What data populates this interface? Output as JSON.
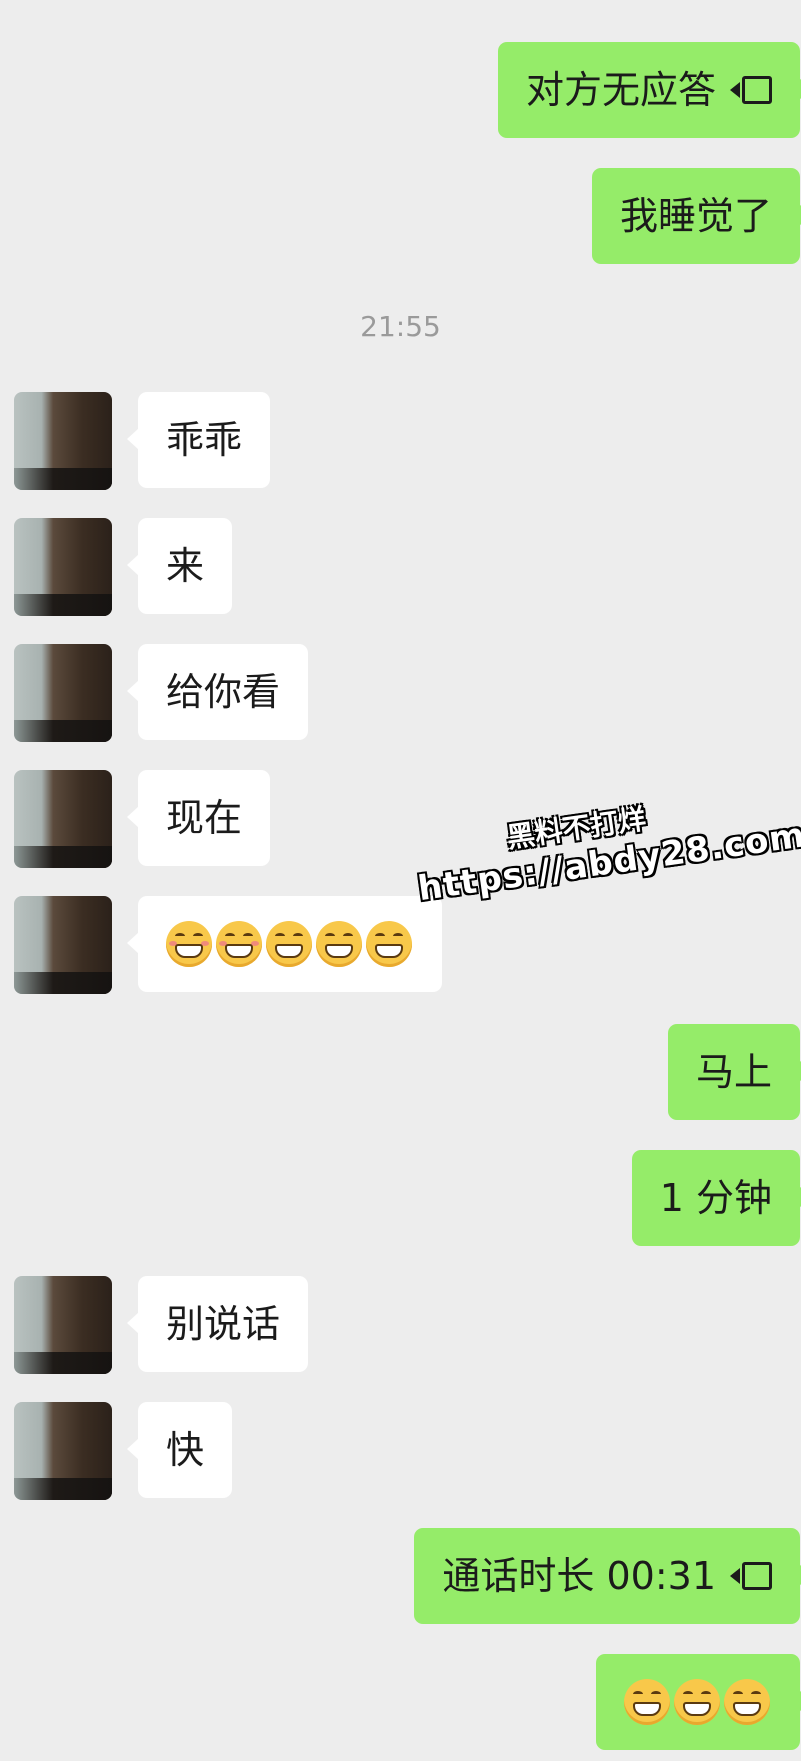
{
  "messages": [
    {
      "side": "sent",
      "text": "对方无应答",
      "call_icon": true
    },
    {
      "side": "sent",
      "text": "我睡觉了"
    },
    {
      "side": "time",
      "text": "21:55"
    },
    {
      "side": "recv",
      "text": "乖乖"
    },
    {
      "side": "recv",
      "text": "来"
    },
    {
      "side": "recv",
      "text": "给你看"
    },
    {
      "side": "recv",
      "text": "现在"
    },
    {
      "side": "recv",
      "emojis": [
        "grimace-blush",
        "grimace-blush",
        "grin",
        "grin",
        "grin"
      ]
    },
    {
      "side": "sent",
      "text": "马上"
    },
    {
      "side": "sent",
      "text": "1 分钟"
    },
    {
      "side": "recv",
      "text": "别说话"
    },
    {
      "side": "recv",
      "text": "快"
    },
    {
      "side": "sent",
      "text": "通话时长 00:31",
      "call_icon": true
    },
    {
      "side": "sent",
      "emojis": [
        "grimace",
        "grimace",
        "grimace"
      ]
    }
  ],
  "watermark": {
    "title": "黑料不打烊",
    "url": "https://abdy28.com"
  },
  "colors": {
    "background": "#ededed",
    "sent_bubble": "#95ec69",
    "received_bubble": "#ffffff"
  }
}
